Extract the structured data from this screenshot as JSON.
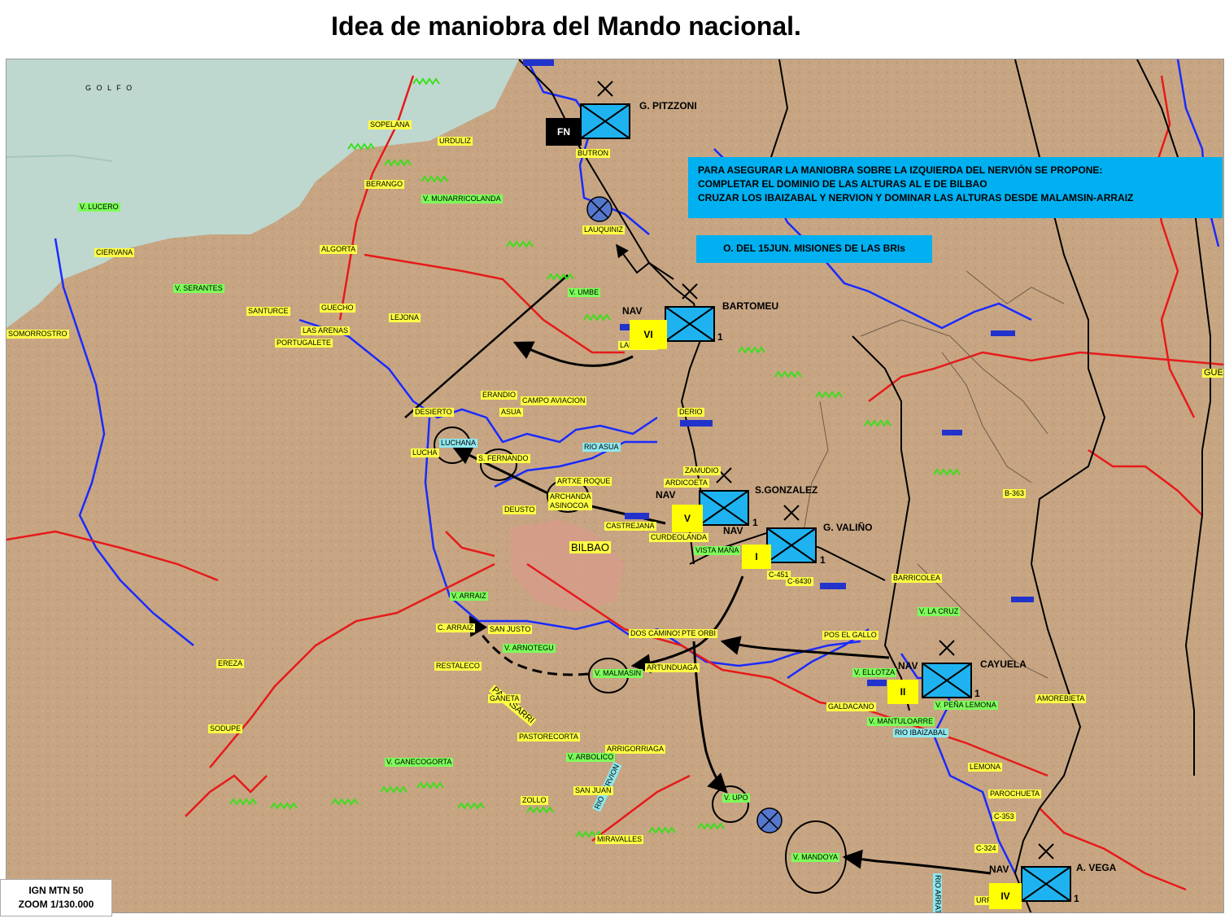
{
  "title": "Idea de maniobra del Mando nacional.",
  "callouts": {
    "main": [
      "PARA ASEGURAR LA MANIOBRA SOBRE LA IZQUIERDA DEL NERVIÓN SE  PROPONE:",
      "COMPLETAR EL DOMINIO DE LAS ALTURAS AL E DE BILBAO",
      "CRUZAR LOS IBAIZABAL Y NERVION Y DOMINAR LAS ALTURAS DESDE  MALAMSIN-ARRAIZ"
    ],
    "order": "O. DEL 15JUN. MISIONES  DE LAS BRIs"
  },
  "units": {
    "pitzzoni": {
      "name": "G. PITZZONI",
      "badge": "FN"
    },
    "bartomeu": {
      "name": "BARTOMEU",
      "prefix": "NAV",
      "badge": "VI",
      "echelon": "1"
    },
    "gonzalez": {
      "name": "S.GONZALEZ",
      "prefix": "NAV",
      "badge": "V",
      "echelon": "1"
    },
    "valino": {
      "name": "G. VALIÑO",
      "prefix": "NAV",
      "badge": "I",
      "echelon": "1"
    },
    "cayuela": {
      "name": "CAYUELA",
      "prefix": "NAV",
      "badge": "II",
      "echelon": "1"
    },
    "vega": {
      "name": "A. VEGA",
      "prefix": "NAV",
      "badge": "IV",
      "echelon": "1"
    }
  },
  "places": {
    "golfo": "G O L F O",
    "sopelana": "SOPELANA",
    "urduliz": "URDULIZ",
    "gbutron": "BUTRON",
    "berango": "BERANGO",
    "munarri": "V. MUNARRICOLANDA",
    "lucero": "V. LUCERO",
    "ciervana": "CIERVANA",
    "algorta": "ALGORTA",
    "lauquiniz": "LAUQUINIZ",
    "serantes": "V. SERANTES",
    "santurce": "SANTURCE",
    "guecho": "GUECHO",
    "lejona": "LEJONA",
    "somorrostro": "SOMORROSTRO",
    "lasarenas": "LAS ARENAS",
    "portugalete": "PORTUGALETE",
    "umbe": "V. UMBE",
    "lanjamiz": "LANJAMIZ",
    "erandio": "ERANDIO",
    "desierto": "DESIERTO",
    "asua": "ASUA",
    "campoaviacion": "CAMPO AVIACION",
    "derio": "DERIO",
    "luchana": "LUCHANA",
    "lucho": "LUCHA",
    "sfernando": "S. FERNANDO",
    "rioasua": "RIO ASUA",
    "artxroque": "ARTXE ROQUE",
    "zamudio": "ZAMUDIO",
    "ardicoeta": "ARDICOETA",
    "archanda": "ARCHANDA ASINOCOA",
    "deusto": "DEUSTO",
    "castrejana": "CASTREJANA",
    "curdeolanda": "CURDEOLANDA",
    "bilbao": "BILBAO",
    "vistaman": "VISTA MAÑA",
    "c451": "C-451",
    "c6430": "C-6430",
    "barricolea": "BARRICOLEA",
    "b363": "B-363",
    "varraiz": "V. ARRAIZ",
    "carraiz": "C. ARRAIZ",
    "sanjusto": "SAN JUSTO",
    "arnotegu": "V. ARNOTEGU",
    "dosca": "DOS CAMINOS",
    "pteorbi": "PTE ORBI",
    "lacruz": "V. LA CRUZ",
    "posgallo": "POS EL GALLO",
    "ereza": "EREZA",
    "restaleco": "RESTALECO",
    "malmasin": "V. MALMASIN",
    "artunduaga": "ARTUNDUAGA",
    "pagasarri": "PAGASARRI",
    "ganeta": "GANETA",
    "pastorecorta": "PASTORECORTA",
    "sodupe": "SODUPE",
    "arrigorriaga": "ARRIGORRIAGA",
    "arbolico": "V. ARBOLICO",
    "rionervion": "RIO NERVION",
    "ganecogorta": "V. GANECOGORTA",
    "sanjuan": "SAN JUAN",
    "zollo": "ZOLLO",
    "miravalles": "MIRAVALLES",
    "vupo": "V. UPO",
    "mandoya": "V. MANDOYA",
    "galdacano": "GALDACANO",
    "mantuloarre": "V. MANTULOARRE",
    "rioibaizabal": "RIO IBAIZABAL",
    "lemona": "LEMONA",
    "penalemona": "V. PEÑA LEMONA",
    "amorebieta": "AMOREBIETA",
    "parochueta": "PAROCHUETA",
    "c353": "C-353",
    "c324": "C-324",
    "rioarratia": "RIO ARRATIA",
    "urre": "URRE",
    "lollotza": "V. ELLOTZA",
    "querr": "GUERR"
  },
  "legend": {
    "line1": "IGN MTN 50",
    "line2": "ZOOM 1/130.000"
  },
  "colors": {
    "sea": "#bcd7cf",
    "land": "#c9ab8a",
    "callout": "#00b0f0",
    "unit": "#1eb3f0",
    "badge": "#ffff00",
    "river": "#1a2bff",
    "road": "#e61a1a"
  }
}
